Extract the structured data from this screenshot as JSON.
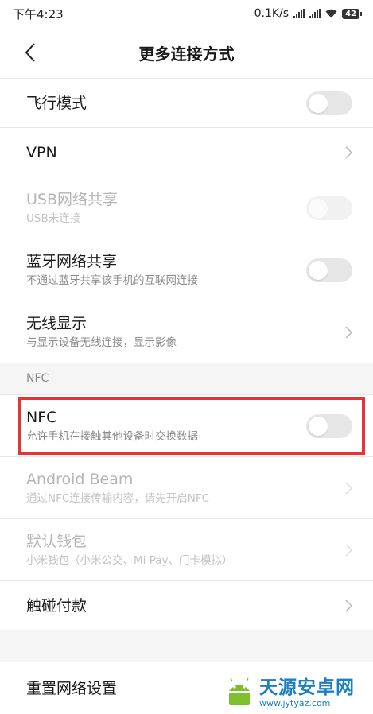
{
  "status_bar": {
    "time": "下午4:23",
    "network_speed": "0.1K/s",
    "battery": "42"
  },
  "header": {
    "title": "更多连接方式"
  },
  "rows": [
    {
      "title": "飞行模式",
      "subtitle": "",
      "control": "toggle",
      "enabled": true,
      "on": false
    },
    {
      "title": "VPN",
      "subtitle": "",
      "control": "chevron",
      "enabled": true
    },
    {
      "title": "USB网络共享",
      "subtitle": "USB未连接",
      "control": "toggle",
      "enabled": false,
      "on": false
    },
    {
      "title": "蓝牙网络共享",
      "subtitle": "不通过蓝牙共享该手机的互联网连接",
      "control": "toggle",
      "enabled": true,
      "on": false
    },
    {
      "title": "无线显示",
      "subtitle": "与显示设备无线连接，显示影像",
      "control": "chevron",
      "enabled": true
    },
    {
      "title": "NFC",
      "subtitle": "允许手机在接触其他设备时交换数据",
      "control": "toggle",
      "enabled": true,
      "on": false
    },
    {
      "title": "Android Beam",
      "subtitle": "通过NFC连接传输内容，请先开启NFC",
      "control": "chevron",
      "enabled": false
    },
    {
      "title": "默认钱包",
      "subtitle": "小米钱包（小米公交、Mi Pay、门卡模拟）",
      "control": "chevron",
      "enabled": false
    },
    {
      "title": "触碰付款",
      "subtitle": "",
      "control": "chevron",
      "enabled": true
    },
    {
      "title": "重置网络设置",
      "subtitle": "",
      "control": "none",
      "enabled": true
    }
  ],
  "section_nfc": {
    "label": "NFC"
  },
  "colors": {
    "highlight": "#e63333",
    "toggle_off": "#e6e6e6",
    "section_bg": "#f5f5f5",
    "watermark": "#1c7fc4"
  },
  "watermark": {
    "title": "天源安卓网",
    "url": "www.jytyaz.com"
  }
}
